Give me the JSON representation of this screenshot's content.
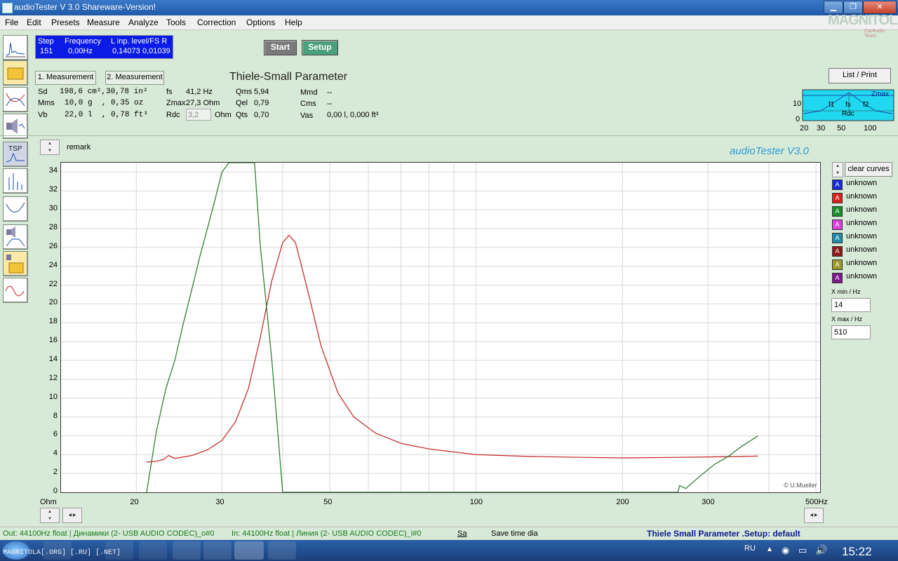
{
  "window": {
    "title": "audioTester  V 3.0 Shareware-Version!"
  },
  "menu": [
    "File",
    "Edit",
    "Presets",
    "Measure",
    "Analyze",
    "Tools",
    "Correction",
    "Options",
    "Help"
  ],
  "logo": {
    "text": "MAGNITOLA",
    "sub": "CarAudio Team"
  },
  "status_box": {
    "step_label": "Step",
    "freq_label": "Frequency",
    "level_label": "L  inp. level/FS  R",
    "step": "151",
    "freq": "0,00Hz",
    "level_l": "0,14073",
    "level_r": "0,01039"
  },
  "buttons": {
    "start": "Start",
    "setup": "Setup",
    "meas1": "1. Measurement",
    "meas2": "2. Measurement",
    "list_print": "List / Print",
    "clear_curves": "clear curves"
  },
  "tsp": {
    "title": "Thiele-Small Parameter",
    "sd_label": "Sd",
    "sd_value": "198,6 cm²,30,78 in²",
    "mms_label": "Mms",
    "mms_value": "10,0 g  , 0,35 oz",
    "vb_label": "Vb",
    "vb_value": "22,0 l  , 0,78 ft³",
    "fs_label": "fs",
    "fs_value": "41,2 Hz",
    "zmax_label": "Zmax",
    "zmax_value": "27,3 Ohm",
    "rdc_label": "Rdc",
    "rdc_value": "3,2",
    "rdc_unit": "Ohm",
    "qms_label": "Qms",
    "qms_value": "5,94",
    "qel_label": "Qel",
    "qel_value": "0,79",
    "qts_label": "Qts",
    "qts_value": "0,70",
    "mmd_label": "Mmd",
    "mmd_value": "--",
    "cms_label": "Cms",
    "cms_value": "--",
    "vas_label": "Vas",
    "vas_value": "0,00 l, 0,000 ft³"
  },
  "mini_chart": {
    "zmax": "Zmax",
    "f1": "f1",
    "fs": "fs",
    "f2": "f2",
    "rdc": "Rdc",
    "y10": "10",
    "y0": "0",
    "x_ticks": [
      "20",
      "30",
      "50",
      "100"
    ]
  },
  "plot": {
    "remark": "remark",
    "brand": "audioTester  V3.0",
    "copyright": "© U.Mueller",
    "y_unit": "Ohm",
    "x_unit_tick": "500Hz"
  },
  "chart_data": {
    "type": "line",
    "xscale": "log",
    "xlim": [
      14,
      510
    ],
    "ylim": [
      0,
      35
    ],
    "yticks": [
      "0",
      "2",
      "4",
      "6",
      "8",
      "10",
      "12",
      "14",
      "16",
      "18",
      "20",
      "22",
      "24",
      "26",
      "28",
      "30",
      "32",
      "34"
    ],
    "xticks": [
      "20",
      "30",
      "50",
      "100",
      "200",
      "300"
    ],
    "series": [
      {
        "name": "impedance",
        "color": "#c0201f",
        "x": [
          21,
          22,
          22.8,
          23.3,
          24,
          26,
          28,
          30,
          32,
          34,
          36,
          38,
          40,
          41.2,
          42.5,
          45,
          48,
          52,
          56,
          62,
          70,
          80,
          100,
          130,
          170,
          200,
          250,
          300,
          350,
          380
        ],
        "y": [
          3.2,
          3.3,
          3.5,
          3.9,
          3.6,
          3.9,
          4.5,
          5.5,
          7.5,
          11,
          16.5,
          22.5,
          26.5,
          27.3,
          26.5,
          21.5,
          15.5,
          10.5,
          8,
          6.3,
          5.2,
          4.6,
          4.0,
          3.8,
          3.7,
          3.65,
          3.7,
          3.75,
          3.8,
          3.85
        ]
      },
      {
        "name": "phase",
        "color": "#207820",
        "x": [
          21,
          22,
          23,
          24,
          25,
          26,
          27,
          28,
          29,
          30,
          31,
          35,
          36,
          37,
          38,
          39,
          40,
          260,
          262,
          270,
          290,
          310,
          330,
          350,
          370,
          380
        ],
        "y": [
          0,
          6.5,
          11,
          14,
          18,
          21.5,
          25,
          28,
          31,
          34,
          35,
          35,
          26,
          20,
          14,
          7,
          0,
          0,
          0.7,
          0.4,
          1.8,
          3,
          3.8,
          4.8,
          5.6,
          6
        ]
      }
    ]
  },
  "legend": [
    {
      "label": "unknown",
      "color": "#1a2ad8"
    },
    {
      "label": "unknown",
      "color": "#d82020"
    },
    {
      "label": "unknown",
      "color": "#1a8a2a"
    },
    {
      "label": "unknown",
      "color": "#d840d8"
    },
    {
      "label": "unknown",
      "color": "#208aa8"
    },
    {
      "label": "unknown",
      "color": "#8a1a1a"
    },
    {
      "label": "unknown",
      "color": "#9a9a2a"
    },
    {
      "label": "unknown",
      "color": "#7a1a8a"
    }
  ],
  "xrange": {
    "min_label": "X min / Hz",
    "min_value": "14",
    "max_label": "X max / Hz",
    "max_value": "510"
  },
  "statusbar": {
    "out": "Out: 44100Hz float  | Динамики (2- USB AUDIO  CODEC)_o#0",
    "in": "In: 44100Hz float  | Линия (2- USB AUDIO  CODEC)_i#0",
    "sa": "Sa",
    "save": "Save time dia",
    "right": "Thiele Small Parameter .Setup:  default"
  },
  "taskbar": {
    "label": "MAGNITOLA[.ORG] [.RU] [.NET]",
    "lang": "RU",
    "clock": "15:22"
  }
}
